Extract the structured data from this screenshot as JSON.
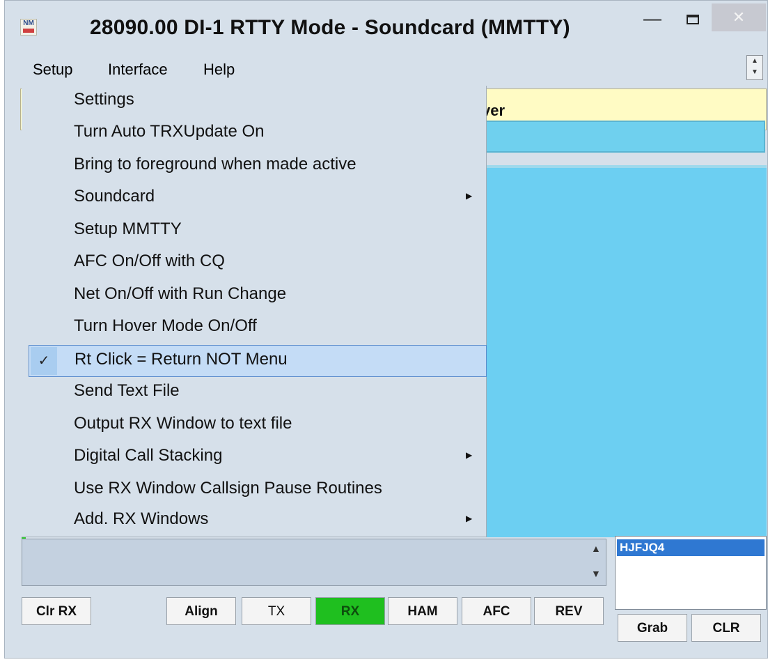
{
  "window": {
    "title": "28090.00  DI-1 RTTY Mode - Soundcard (MMTTY)",
    "logo_text": "NM",
    "minimize_glyph": "—",
    "close_glyph": "✕"
  },
  "menubar": {
    "items": [
      "Setup",
      "Interface",
      "Help"
    ]
  },
  "background": {
    "receiver_label": "ver"
  },
  "setup_menu": {
    "items": [
      {
        "label": "Settings"
      },
      {
        "label": "Turn Auto TRXUpdate On"
      },
      {
        "label": "Bring to foreground when made active"
      },
      {
        "label": "Soundcard",
        "submenu": true
      },
      {
        "label": "Setup MMTTY"
      },
      {
        "label": "AFC On/Off with CQ"
      },
      {
        "label": "Net On/Off with Run Change"
      },
      {
        "label": "Turn Hover Mode On/Off"
      },
      {
        "label": "Rt Click = Return NOT Menu",
        "checked": true
      },
      {
        "label": "Send Text File"
      },
      {
        "label": "Output RX Window to text file"
      },
      {
        "label": "Digital Call Stacking",
        "submenu": true
      },
      {
        "label": "Use RX Window Callsign Pause Routines"
      },
      {
        "label": "Add. RX Windows",
        "submenu": true
      }
    ],
    "check_glyph": "✓",
    "submenu_glyph": "▶"
  },
  "callsign_list": {
    "items": [
      "HJFJQ4"
    ]
  },
  "buttons": {
    "clr_rx": "Clr RX",
    "align": "Align",
    "tx": "TX",
    "rx": "RX",
    "ham": "HAM",
    "afc": "AFC",
    "rev": "REV",
    "grab": "Grab",
    "clr": "CLR"
  },
  "colors": {
    "rx_pane": "#6ccff2",
    "rx_active_button": "#1fbf1f",
    "menu_highlight": "#c4dcf6",
    "callsign_selected": "#2f78d2",
    "header_strip": "#fffbc4"
  }
}
